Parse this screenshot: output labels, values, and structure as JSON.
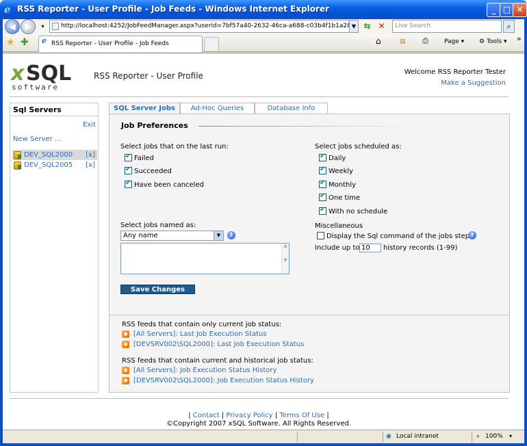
{
  "window": {
    "title": "RSS Reporter - User Profile - Job Feeds - Windows Internet Explorer",
    "minimize": "_",
    "maximize": "□",
    "close": "✕"
  },
  "browser": {
    "url": "http://localhost:4252/JobFeedManager.aspx?userid=7bf57a40-2632-46ca-a688-c03b4f1b1a28&serverid=",
    "search_placeholder": "Live Search",
    "tab_title": "RSS Reporter - User Profile - Job Feeds",
    "page_menu": "Page",
    "tools_menu": "Tools",
    "chevron": "»",
    "status_zone": "Local intranet",
    "zoom": "100%"
  },
  "header": {
    "logo_x": "x",
    "logo_sql": "SQL",
    "logo_software": "software",
    "title": "RSS Reporter - User Profile",
    "welcome": "Welcome RSS Reporter Tester",
    "suggestion": "Make a Suggestion"
  },
  "sidebar": {
    "title": "Sql Servers",
    "exit": "Exit",
    "new_server": "New Server ...",
    "servers": [
      {
        "name": "DEV_SQL2000",
        "delete": "[x]"
      },
      {
        "name": "DEV_SQL2005",
        "delete": "[x]"
      }
    ]
  },
  "tabs": [
    "SQL Server Jobs",
    "Ad-Hoc Queries",
    "Database Info"
  ],
  "prefs": {
    "title": "Job Preferences",
    "last_run_label": "Select jobs that on the last run:",
    "last_run": [
      {
        "label": "Failed",
        "checked": true
      },
      {
        "label": "Succeeded",
        "checked": true
      },
      {
        "label": "Have been canceled",
        "checked": true
      }
    ],
    "scheduled_label": "Select jobs scheduled as:",
    "scheduled": [
      {
        "label": "Daily",
        "checked": true
      },
      {
        "label": "Weekly",
        "checked": true
      },
      {
        "label": "Monthly",
        "checked": true
      },
      {
        "label": "One time",
        "checked": true
      },
      {
        "label": "With no schedule",
        "checked": true
      }
    ],
    "named_label": "Select jobs named as:",
    "named_value": "Any name",
    "misc_label": "Miscellaneous",
    "display_sql": {
      "label": "Display the Sql command of the jobs steps",
      "checked": false
    },
    "include_prefix": "Include up to",
    "history_value": "10",
    "include_suffix": "history records (1-99)",
    "save": "Save Changes",
    "help": "?"
  },
  "feeds": {
    "current_label": "RSS feeds that contain only current job status:",
    "current": [
      "[All Servers]: Last Job Execution Status",
      "[DEVSRV002\\SQL2000]: Last Job Execution Status"
    ],
    "history_label": "RSS feeds that contain current and historical job status:",
    "history": [
      "[All Servers]: Job Execution Status History",
      "[DEVSRV002\\SQL2000]: Job Execution Status History"
    ]
  },
  "footer": {
    "contact": "Contact",
    "privacy": "Privacy Policy",
    "terms": "Terms Of Use",
    "copyright": "©Copyright 2007 xSQL Software. All Rights Reserved."
  }
}
